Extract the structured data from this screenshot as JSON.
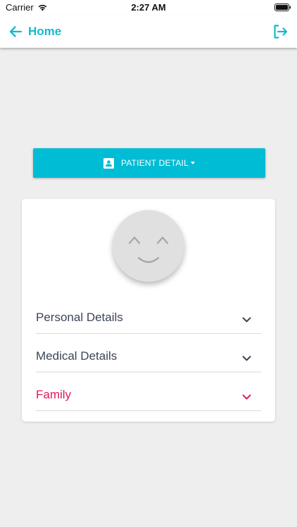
{
  "status_bar": {
    "carrier": "Carrier",
    "time": "2:27 AM"
  },
  "header": {
    "back_label": "Home",
    "accent_color": "#14b9cf"
  },
  "patient_detail_button": {
    "label": "PATIENT DETAIL",
    "color": "#00bcd4"
  },
  "card": {
    "sections": [
      {
        "label": "Personal Details",
        "active": false
      },
      {
        "label": "Medical Details",
        "active": false
      },
      {
        "label": "Family",
        "active": true
      }
    ],
    "active_color": "#e0195f"
  }
}
